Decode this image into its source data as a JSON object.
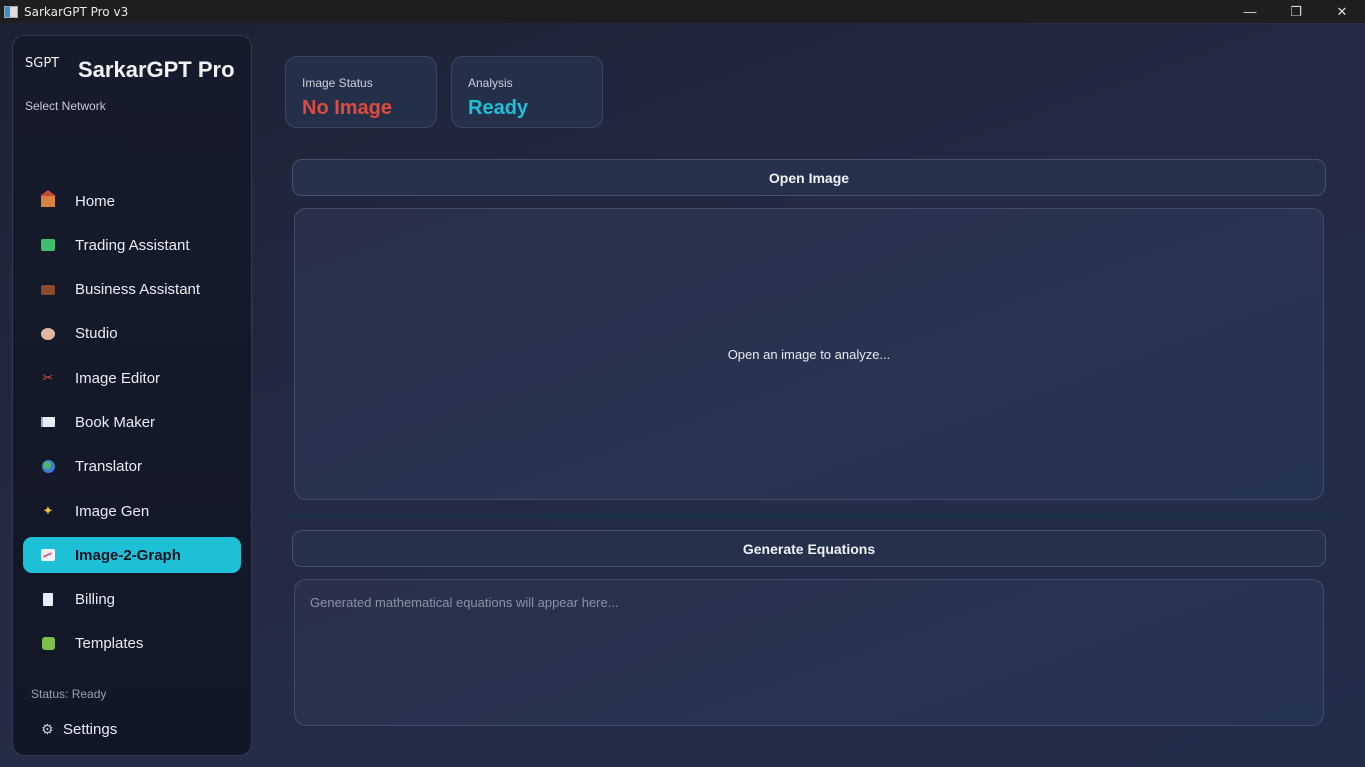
{
  "window": {
    "title": "SarkarGPT Pro v3",
    "controls": {
      "minimize": "—",
      "maximize": "❐",
      "close": "✕"
    }
  },
  "sidebar": {
    "logo": "SGPT",
    "brand": "SarkarGPT Pro",
    "network_label": "Select Network",
    "items": [
      {
        "label": "Home",
        "icon": "house-icon"
      },
      {
        "label": "Trading Assistant",
        "icon": "chart-icon"
      },
      {
        "label": "Business Assistant",
        "icon": "briefcase-icon"
      },
      {
        "label": "Studio",
        "icon": "palette-icon"
      },
      {
        "label": "Image Editor",
        "icon": "scissors-icon"
      },
      {
        "label": "Book Maker",
        "icon": "book-icon"
      },
      {
        "label": "Translator",
        "icon": "globe-icon"
      },
      {
        "label": "Image Gen",
        "icon": "sparkles-icon"
      },
      {
        "label": "Image-2-Graph",
        "icon": "graph-icon",
        "active": true
      },
      {
        "label": "Billing",
        "icon": "receipt-icon"
      },
      {
        "label": "Templates",
        "icon": "puzzle-icon"
      }
    ],
    "status": "Status: Ready",
    "settings": {
      "label": "Settings",
      "icon": "gear-icon"
    },
    "accent": "#1ec0d8"
  },
  "cards": {
    "image_status": {
      "caption": "Image Status",
      "value": "No Image",
      "color": "#e04a3e"
    },
    "analysis": {
      "caption": "Analysis",
      "value": "Ready",
      "color": "#1ec0d8"
    }
  },
  "image_panel": {
    "open_button": "Open Image",
    "placeholder": "Open an image to analyze..."
  },
  "equations": {
    "generate_button": "Generate Equations",
    "placeholder": "Generated mathematical equations will appear here..."
  }
}
